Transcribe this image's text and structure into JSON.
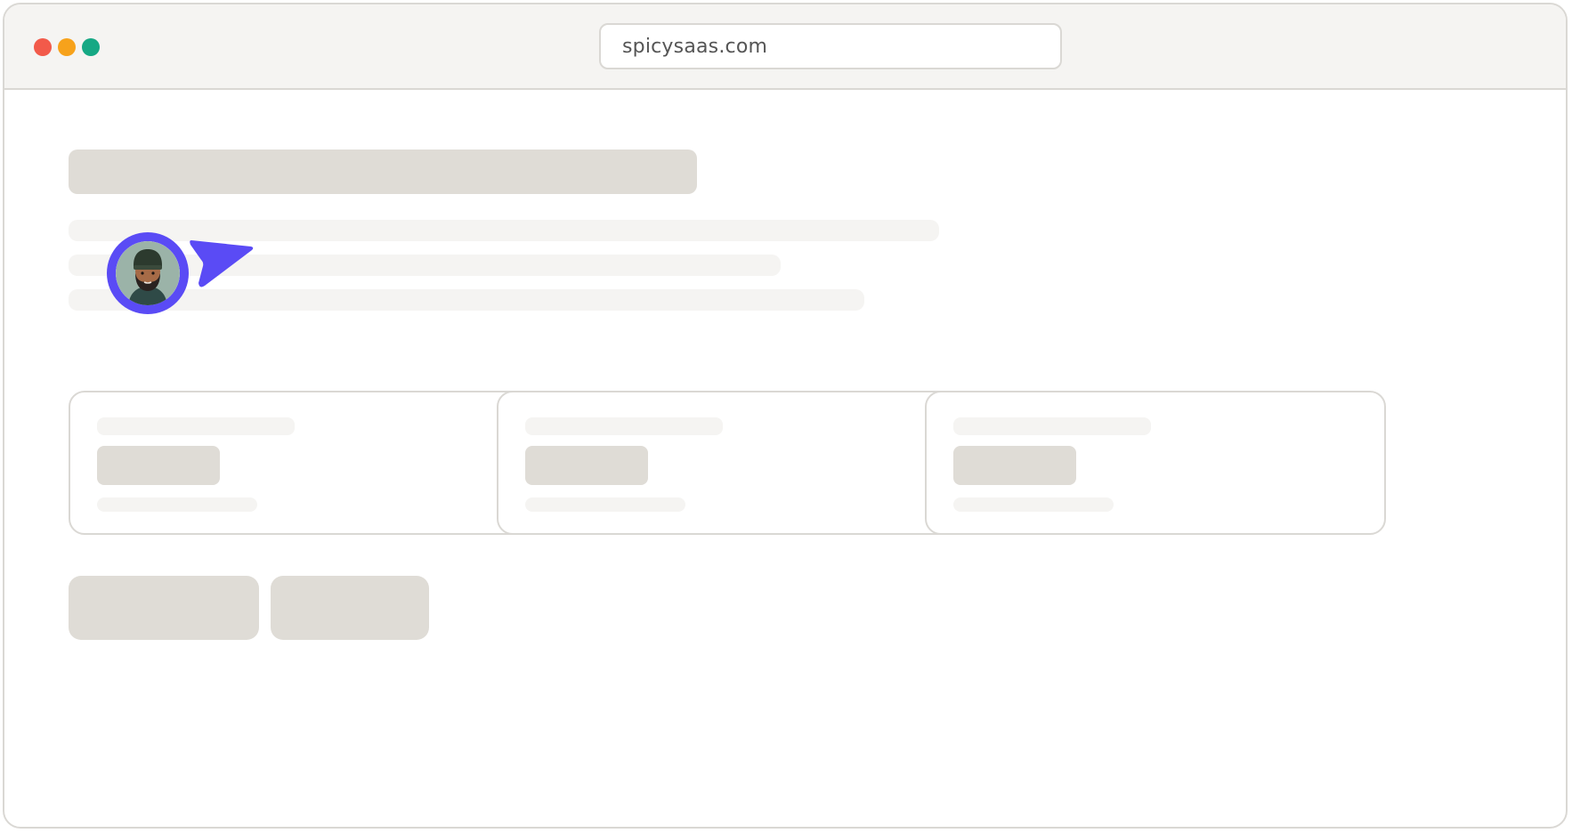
{
  "browser": {
    "url": "spicysaas.com",
    "traffic_lights": {
      "close": "#f25a4a",
      "minimize": "#f7a21b",
      "maximize": "#16a884"
    }
  },
  "colors": {
    "accent": "#5a4bf5",
    "skeleton_dark": "#dfdcd6",
    "skeleton_light": "#f5f4f2",
    "border": "#dad8d4"
  },
  "cursor": {
    "avatar_icon": "user-avatar-icon",
    "pointer_icon": "cursor-pointer-icon"
  },
  "cards": [
    {
      "name": "stat-card-1"
    },
    {
      "name": "stat-card-2"
    },
    {
      "name": "stat-card-3"
    }
  ]
}
